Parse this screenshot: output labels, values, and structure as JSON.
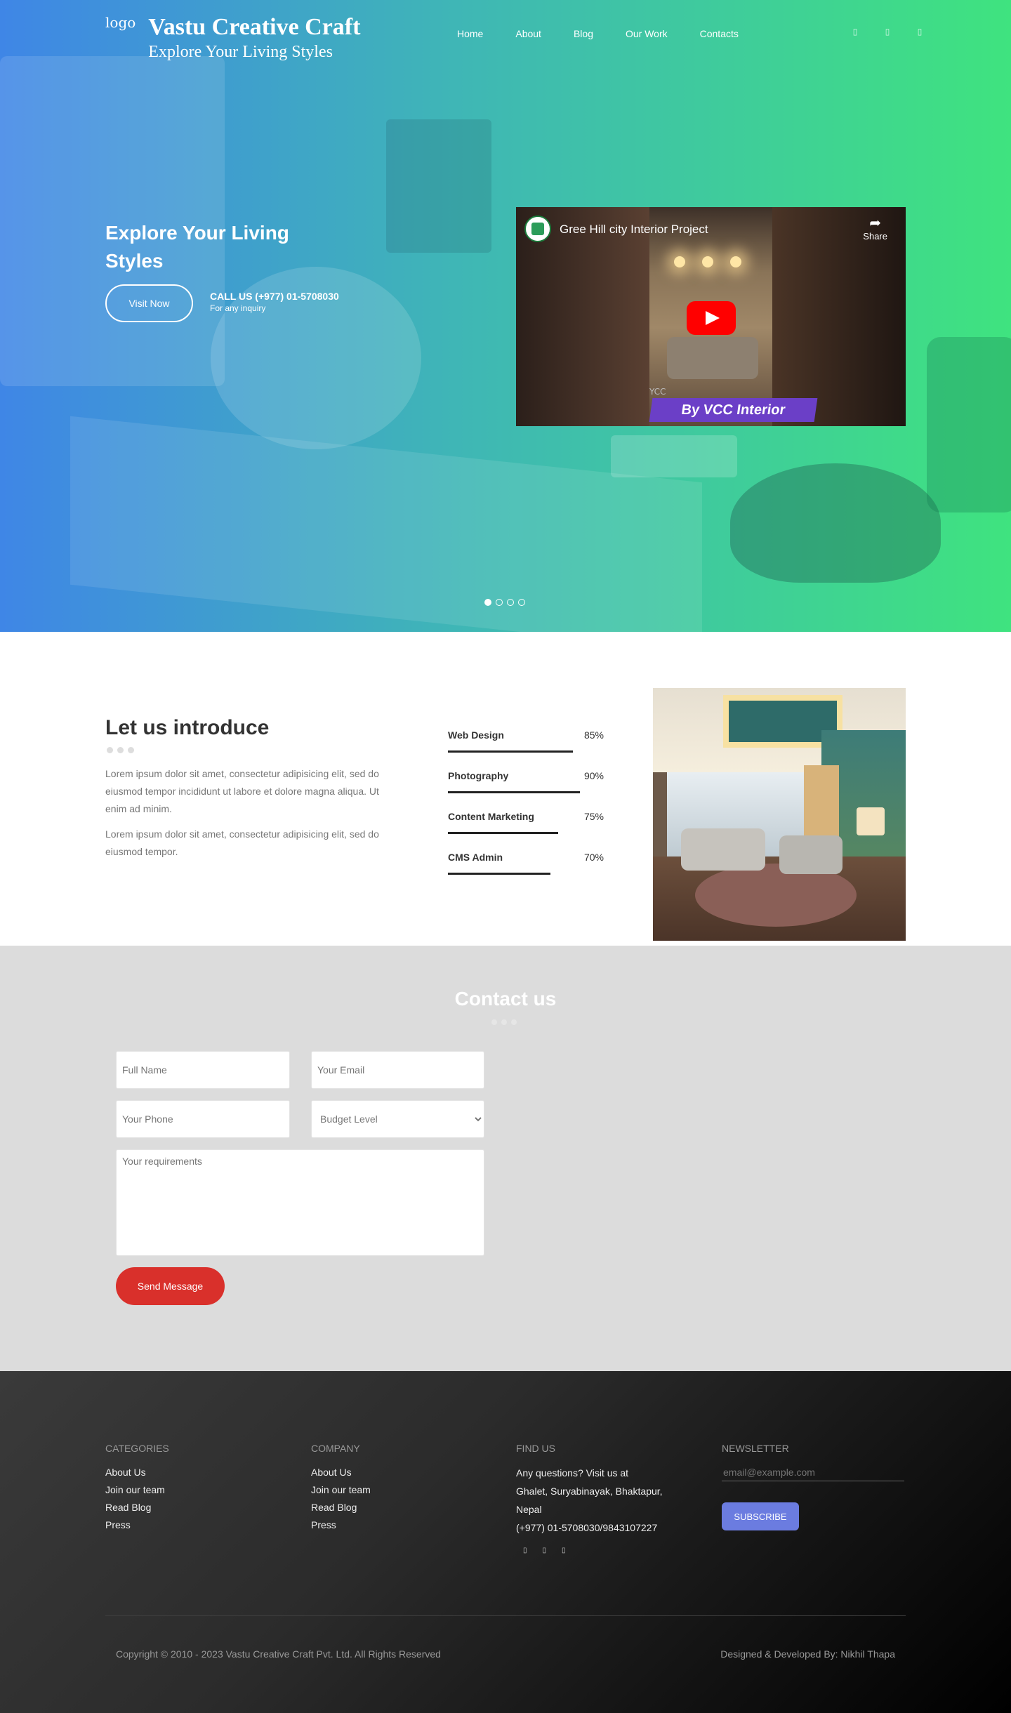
{
  "brand": {
    "logo_alt": "logo",
    "name": "Vastu Creative Craft",
    "tagline": "Explore Your Living Styles"
  },
  "nav": {
    "items": [
      "Home",
      "About",
      "Blog",
      "Our Work",
      "Contacts"
    ]
  },
  "social_top": [
    "social-icon-1",
    "social-icon-2",
    "social-icon-3"
  ],
  "hero": {
    "title": "Explore Your Living Styles",
    "visit_button": "Visit Now",
    "call_main": "CALL US (+977) 01-5708030",
    "call_sub": "For any inquiry",
    "video": {
      "title": "Gree Hill city Interior Project",
      "share_label": "Share",
      "watermark": "YCC",
      "banner": "By VCC Interior"
    },
    "slider_dots": 4,
    "active_dot": 0
  },
  "intro": {
    "title": "Let us introduce",
    "paragraph1": "Lorem ipsum dolor sit amet, consectetur adipisicing elit, sed do eiusmod tempor incididunt ut labore et dolore magna aliqua. Ut enim ad minim.",
    "paragraph2": "Lorem ipsum dolor sit amet, consectetur adipisicing elit, sed do eiusmod tempor.",
    "skills": [
      {
        "name": "Web Design",
        "value": "85%",
        "level": 85
      },
      {
        "name": "Photography",
        "value": "90%",
        "level": 90
      },
      {
        "name": "Content Marketing",
        "value": "75%",
        "level": 75
      },
      {
        "name": "CMS Admin",
        "value": "70%",
        "level": 70
      }
    ]
  },
  "contact": {
    "title": "Contact us",
    "full_name_placeholder": "Full Name",
    "email_placeholder": "Your Email",
    "phone_placeholder": "Your Phone",
    "budget_selected": "Budget Level",
    "requirements_placeholder": "Your requirements",
    "send_button": "Send Message"
  },
  "footer": {
    "categories": {
      "title": "CATEGORIES",
      "links": [
        "About Us",
        "Join our team",
        "Read Blog",
        "Press"
      ]
    },
    "company": {
      "title": "COMPANY",
      "links": [
        "About Us",
        "Join our team",
        "Read Blog",
        "Press"
      ]
    },
    "find_us": {
      "title": "FIND US",
      "line1": "Any questions? Visit us at",
      "line2": "Ghalet, Suryabinayak, Bhaktapur, Nepal",
      "phone": "(+977) 01-5708030/9843107227"
    },
    "newsletter": {
      "title": "NEWSLETTER",
      "email_placeholder": "email@example.com",
      "subscribe": "SUBSCRIBE"
    },
    "copyright": "Copyright © 2010 - 2023 Vastu Creative Craft Pvt. Ltd. All Rights Reserved",
    "designed_by": "Designed & Developed By: Nikhil Thapa"
  }
}
